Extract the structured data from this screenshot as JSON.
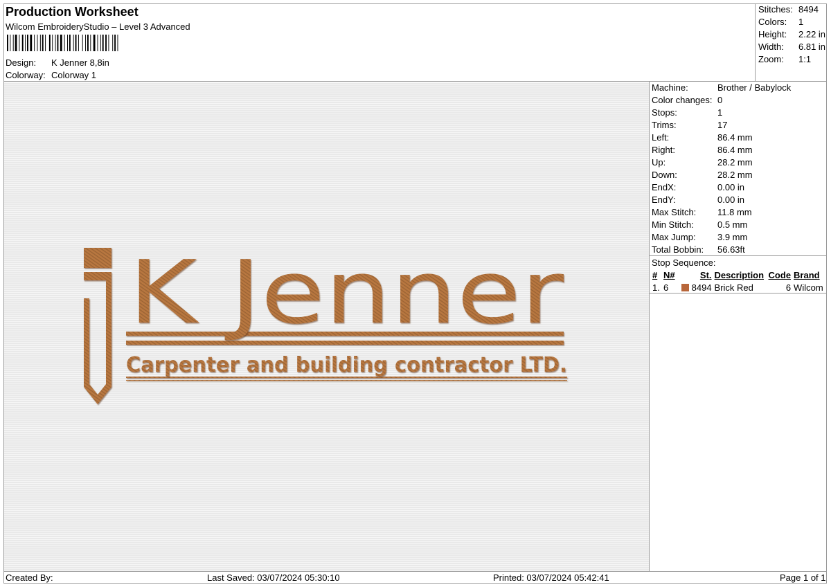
{
  "header": {
    "title": "Production Worksheet",
    "subtitle": "Wilcom EmbroideryStudio – Level 3 Advanced",
    "design_label": "Design:",
    "design_value": "K Jenner 8,8in",
    "colorway_label": "Colorway:",
    "colorway_value": "Colorway 1"
  },
  "summary": {
    "stitches_label": "Stitches:",
    "stitches_value": "8494",
    "colors_label": "Colors:",
    "colors_value": "1",
    "height_label": "Height:",
    "height_value": "2.22 in",
    "width_label": "Width:",
    "width_value": "6.81 in",
    "zoom_label": "Zoom:",
    "zoom_value": "1:1"
  },
  "design": {
    "main_text": "K Jenner",
    "tagline": "Carpenter and building contractor LTD.",
    "thread_color": "#b8773f"
  },
  "props": [
    {
      "label": "Machine:",
      "value": "Brother / Babylock"
    },
    {
      "label": "Color changes:",
      "value": "0"
    },
    {
      "label": "Stops:",
      "value": "1"
    },
    {
      "label": "Trims:",
      "value": "17"
    },
    {
      "label": "Left:",
      "value": "86.4 mm"
    },
    {
      "label": "Right:",
      "value": "86.4 mm"
    },
    {
      "label": "Up:",
      "value": "28.2 mm"
    },
    {
      "label": "Down:",
      "value": "28.2 mm"
    },
    {
      "label": "EndX:",
      "value": "0.00 in"
    },
    {
      "label": "EndY:",
      "value": "0.00 in"
    },
    {
      "label": "Max Stitch:",
      "value": "11.8 mm"
    },
    {
      "label": "Min Stitch:",
      "value": "0.5 mm"
    },
    {
      "label": "Max Jump:",
      "value": "3.9 mm"
    },
    {
      "label": "Total Bobbin:",
      "value": "56.63ft"
    }
  ],
  "stop_sequence": {
    "label": "Stop Sequence:",
    "headers": {
      "num": "#",
      "n": "N#",
      "st": "St.",
      "description": "Description",
      "code": "Code",
      "brand": "Brand"
    },
    "rows": [
      {
        "num": "1.",
        "n": "6",
        "swatch": "#b8663a",
        "st": "8494",
        "description": "Brick Red",
        "code": "6",
        "brand": "Wilcom"
      }
    ]
  },
  "footer": {
    "created_by": "Created By:",
    "last_saved": "Last Saved: 03/07/2024 05:30:10",
    "printed": "Printed: 03/07/2024 05:42:41",
    "page": "Page 1 of 1"
  }
}
